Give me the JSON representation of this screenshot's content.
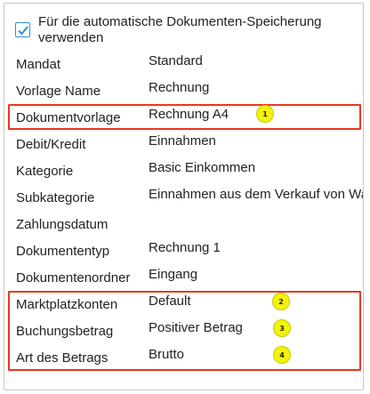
{
  "checkbox": {
    "label": "Für die automatische Dokumenten-Speicherung verwenden",
    "checked": true
  },
  "fields": [
    {
      "label": "Mandat",
      "value": "Standard"
    },
    {
      "label": "Vorlage Name",
      "value": "Rechnung"
    },
    {
      "label": "Dokumentvorlage",
      "value": "Rechnung A4"
    },
    {
      "label": "Debit/Kredit",
      "value": "Einnahmen"
    },
    {
      "label": "Kategorie",
      "value": "Basic Einkommen"
    },
    {
      "label": "Subkategorie",
      "value": "Einnahmen aus dem Verkauf von Wa"
    },
    {
      "label": "Zahlungsdatum",
      "value": ""
    },
    {
      "label": "Dokumententyp",
      "value": "Rechnung 1"
    },
    {
      "label": "Dokumentenordner",
      "value": "Eingang"
    },
    {
      "label": "Marktplatzkonten",
      "value": "Default"
    },
    {
      "label": "Buchungsbetrag",
      "value": "Positiver Betrag"
    },
    {
      "label": "Art des Betrags",
      "value": "Brutto"
    }
  ],
  "badges": [
    "1",
    "2",
    "3",
    "4"
  ],
  "colors": {
    "highlight": "#e8391f",
    "badge": "#f2f20a",
    "checkbox": "#2d8fd5"
  }
}
